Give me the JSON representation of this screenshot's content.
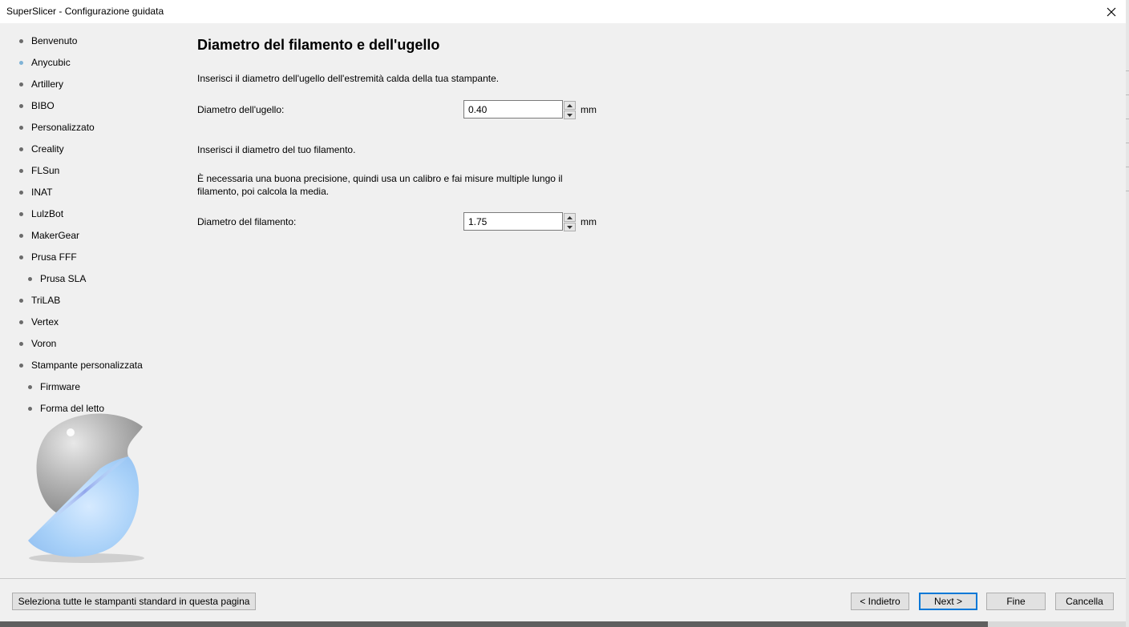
{
  "window": {
    "title": "SuperSlicer - Configurazione guidata",
    "close_icon": "close-icon"
  },
  "sidebar": {
    "items": [
      {
        "label": "Benvenuto",
        "level": 0,
        "active": false
      },
      {
        "label": "Anycubic",
        "level": 0,
        "active": true
      },
      {
        "label": "Artillery",
        "level": 0,
        "active": false
      },
      {
        "label": "BIBO",
        "level": 0,
        "active": false
      },
      {
        "label": "Personalizzato",
        "level": 0,
        "active": false
      },
      {
        "label": "Creality",
        "level": 0,
        "active": false
      },
      {
        "label": "FLSun",
        "level": 0,
        "active": false
      },
      {
        "label": "INAT",
        "level": 0,
        "active": false
      },
      {
        "label": "LulzBot",
        "level": 0,
        "active": false
      },
      {
        "label": "MakerGear",
        "level": 0,
        "active": false
      },
      {
        "label": "Prusa FFF",
        "level": 0,
        "active": false
      },
      {
        "label": "Prusa SLA",
        "level": 1,
        "active": false
      },
      {
        "label": "TriLAB",
        "level": 0,
        "active": false
      },
      {
        "label": "Vertex",
        "level": 0,
        "active": false
      },
      {
        "label": "Voron",
        "level": 0,
        "active": false
      },
      {
        "label": "Stampante personalizzata",
        "level": 0,
        "active": false
      },
      {
        "label": "Firmware",
        "level": 1,
        "active": false
      },
      {
        "label": "Forma del letto",
        "level": 1,
        "active": false
      }
    ],
    "colors": {
      "bullet": "#6b6b6b",
      "bullet_active": "#7fb3d6"
    }
  },
  "main": {
    "title": "Diametro del filamento e dell'ugello",
    "nozzle_intro": "Inserisci il diametro dell'ugello dell'estremità calda della tua stampante.",
    "nozzle_label": "Diametro dell'ugello:",
    "nozzle_value": "0.40",
    "nozzle_unit": "mm",
    "filament_intro": "Inserisci il diametro del tuo filamento.",
    "filament_note": "È necessaria una buona precisione, quindi usa un calibro e fai misure multiple lungo il filamento, poi calcola la media.",
    "filament_label": "Diametro del filamento:",
    "filament_value": "1.75",
    "filament_unit": "mm"
  },
  "footer": {
    "select_all_label": "Seleziona tutte le stampanti standard in questa pagina",
    "back_label": "< Indietro",
    "next_label": "Next >",
    "finish_label": "Fine",
    "cancel_label": "Cancella",
    "accent": "#0078d7"
  }
}
